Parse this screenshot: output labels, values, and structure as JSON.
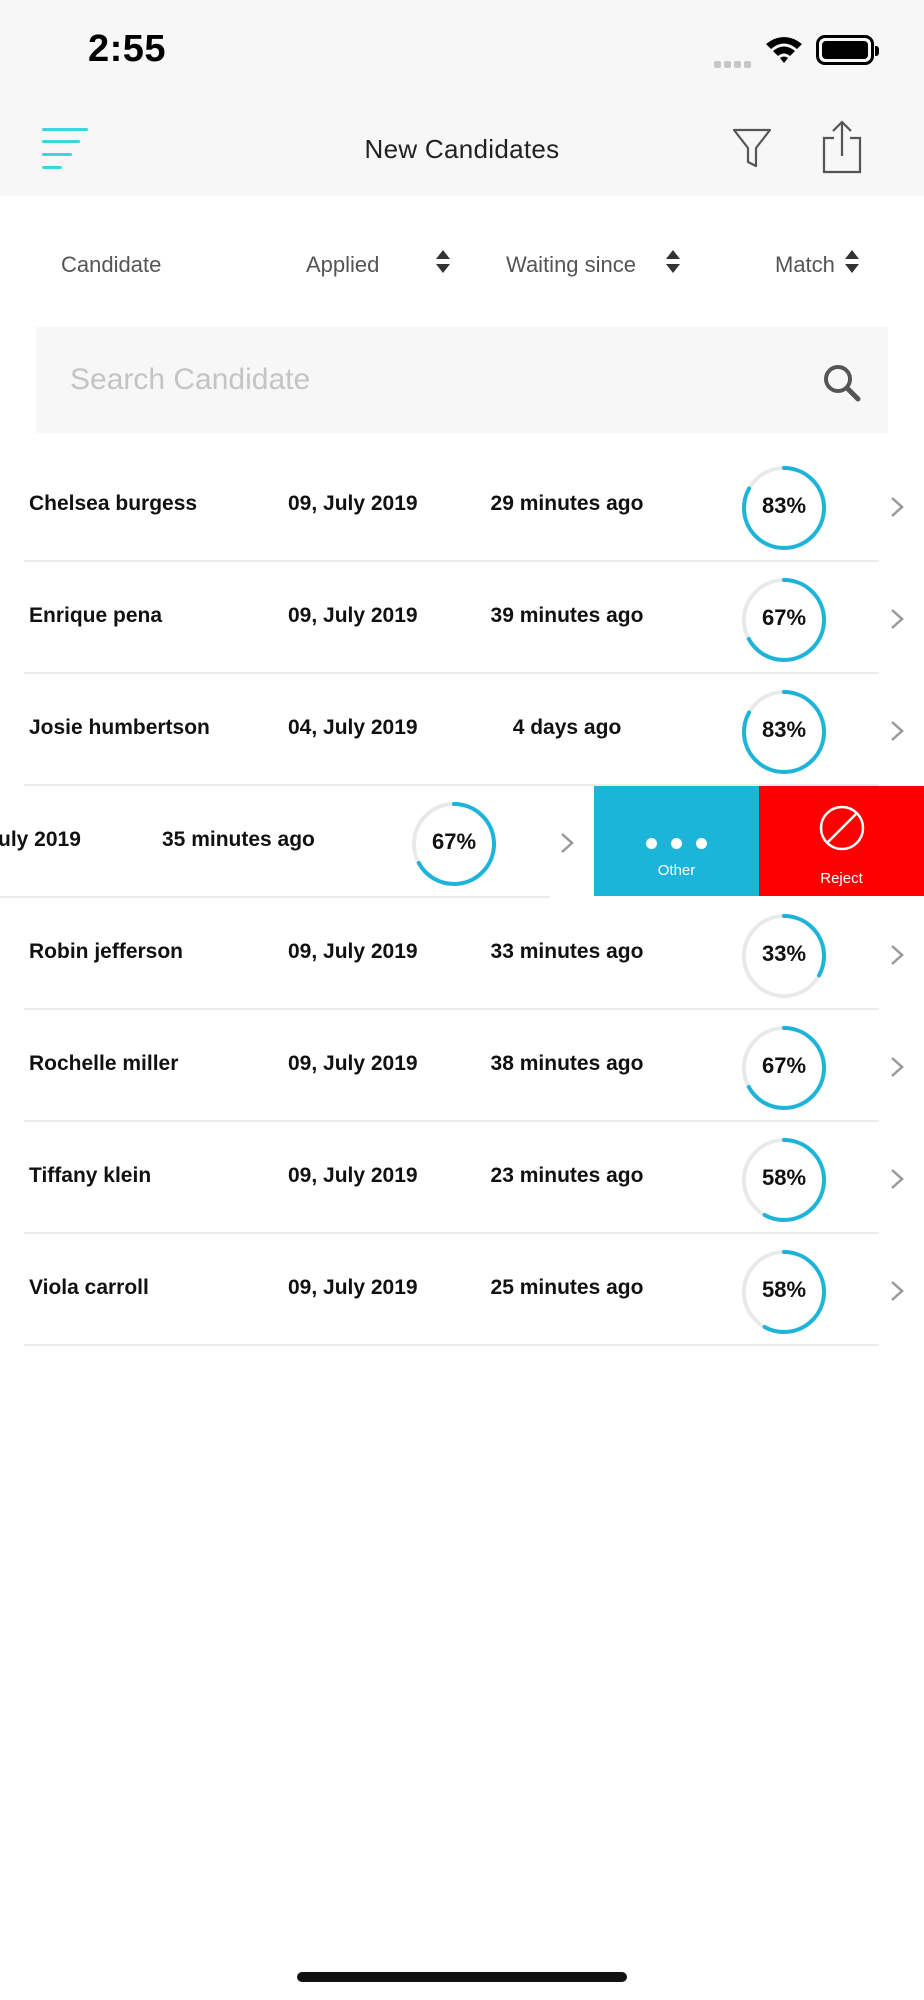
{
  "status_bar": {
    "time": "2:55"
  },
  "nav": {
    "title": "New Candidates"
  },
  "columns": {
    "candidate": "Candidate",
    "applied": "Applied",
    "waiting": "Waiting since",
    "match": "Match"
  },
  "search": {
    "placeholder": "Search Candidate"
  },
  "rows": [
    {
      "name": "Chelsea burgess",
      "applied": "09, July 2019",
      "waiting": "29 minutes ago",
      "match": "83%",
      "match_value": 83
    },
    {
      "name": "Enrique pena",
      "applied": "09, July 2019",
      "waiting": "39 minutes ago",
      "match": "67%",
      "match_value": 67
    },
    {
      "name": "Josie humbertson",
      "applied": "04, July 2019",
      "waiting": "4 days ago",
      "match": "83%",
      "match_value": 83
    },
    {
      "name": "Robin jefferson",
      "applied": "09, July 2019",
      "waiting": "33 minutes ago",
      "match": "33%",
      "match_value": 33
    },
    {
      "name": "Rochelle miller",
      "applied": "09, July 2019",
      "waiting": "38 minutes ago",
      "match": "67%",
      "match_value": 67
    },
    {
      "name": "Tiffany klein",
      "applied": "09, July 2019",
      "waiting": "23 minutes ago",
      "match": "58%",
      "match_value": 58
    },
    {
      "name": "Viola carroll",
      "applied": "09, July 2019",
      "waiting": "25 minutes ago",
      "match": "58%",
      "match_value": 58
    }
  ],
  "swiped_row": {
    "applied": "uly 2019",
    "waiting": "35 minutes ago",
    "match": "67%",
    "match_value": 67,
    "actions": {
      "other": "Other",
      "reject": "Reject"
    }
  },
  "colors": {
    "accent": "#1cb4d8",
    "reject": "#ff0000",
    "ring_track": "#e9e9e9",
    "menu": "#3fd3e0"
  }
}
